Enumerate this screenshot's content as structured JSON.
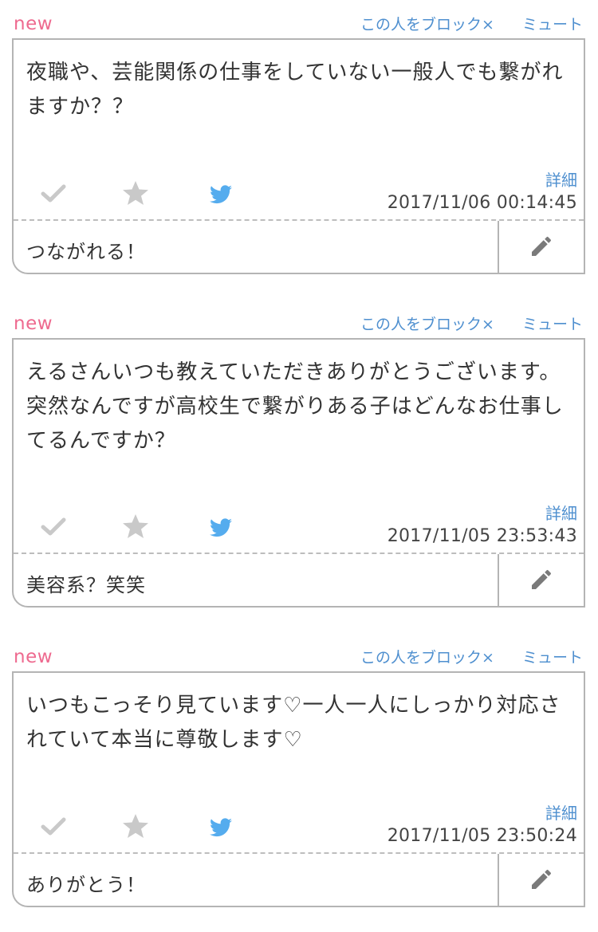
{
  "header_links": {
    "new_label": "new",
    "block_label": "この人をブロック×",
    "mute_label": "ミュート",
    "detail_label": "詳細"
  },
  "icons": {
    "check": "check-icon",
    "star": "star-icon",
    "twitter": "twitter-icon",
    "edit": "pencil-icon"
  },
  "colors": {
    "new": "#ee6a8f",
    "link": "#4e8fcf",
    "twitter": "#55acee",
    "icon_gray": "#c9c9c9",
    "border": "#b4b4b4"
  },
  "posts": [
    {
      "question": "夜職や、芸能関係の仕事をしていない一般人でも繋がれますか？？",
      "timestamp": "2017/11/06 00:14:45",
      "answer": "つながれる！"
    },
    {
      "question": "えるさんいつも教えていただきありがとうございます。突然なんですが高校生で繋がりある子はどんなお仕事してるんですか？",
      "timestamp": "2017/11/05 23:53:43",
      "answer": "美容系？笑笑"
    },
    {
      "question": "いつもこっそり見ています♡一人一人にしっかり対応されていて本当に尊敬します♡",
      "timestamp": "2017/11/05 23:50:24",
      "answer": "ありがとう！"
    }
  ]
}
